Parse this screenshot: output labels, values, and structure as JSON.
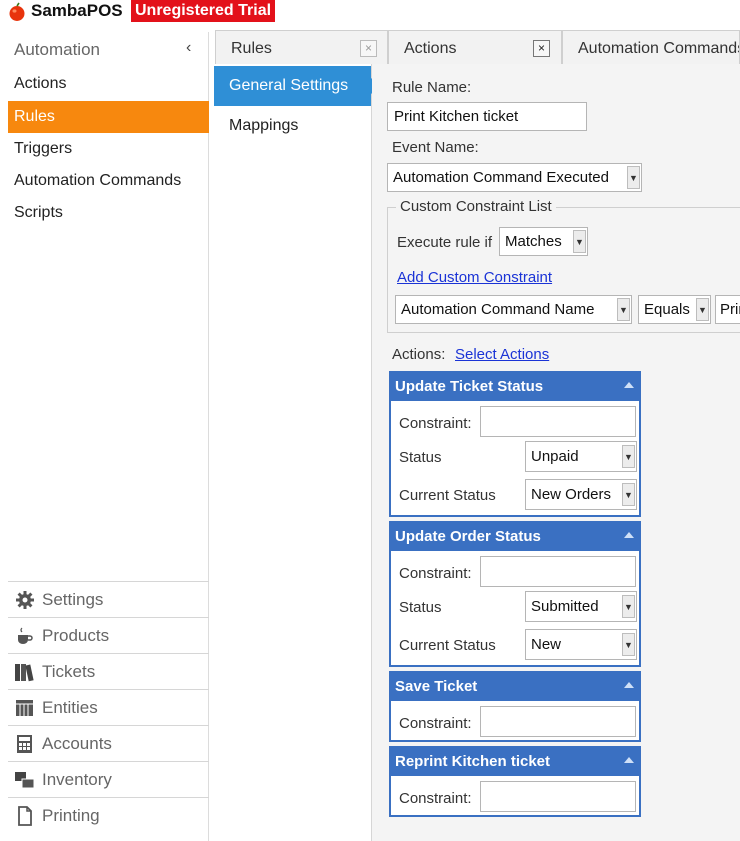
{
  "app": {
    "name": "SambaPOS",
    "trial_badge": "Unregistered Trial"
  },
  "sidebar": {
    "title": "Automation",
    "collapse_glyph": "‹",
    "items": [
      {
        "label": "Actions",
        "active": false
      },
      {
        "label": "Rules",
        "active": true
      },
      {
        "label": "Triggers",
        "active": false
      },
      {
        "label": "Automation Commands",
        "active": false
      },
      {
        "label": "Scripts",
        "active": false
      }
    ],
    "sections": [
      {
        "label": "Settings",
        "icon": "gear-icon"
      },
      {
        "label": "Products",
        "icon": "coffee-cup-icon"
      },
      {
        "label": "Tickets",
        "icon": "books-icon"
      },
      {
        "label": "Entities",
        "icon": "table-grid-icon"
      },
      {
        "label": "Accounts",
        "icon": "calculator-icon"
      },
      {
        "label": "Inventory",
        "icon": "boxes-icon"
      },
      {
        "label": "Printing",
        "icon": "document-icon"
      }
    ]
  },
  "tabs": [
    {
      "label": "Rules",
      "close": "×"
    },
    {
      "label": "Actions",
      "close": "×"
    },
    {
      "label": "Automation Commands"
    }
  ],
  "subnav": {
    "items": [
      {
        "label": "General Settings",
        "active": true
      },
      {
        "label": "Mappings",
        "active": false
      }
    ]
  },
  "form": {
    "rule_name_label": "Rule Name:",
    "rule_name_value": "Print Kitchen ticket",
    "event_name_label": "Event Name:",
    "event_name_value": "Automation Command Executed",
    "constraint_group_title": "Custom Constraint List",
    "execute_rule_label": "Execute rule if",
    "execute_rule_value": "Matches",
    "add_constraint_link": "Add Custom Constraint",
    "constraint_field": "Automation Command Name",
    "constraint_operator": "Equals",
    "constraint_value": "Print Kitchen ticket",
    "actions_label": "Actions:",
    "select_actions_link": "Select Actions"
  },
  "actions": [
    {
      "title": "Update Ticket Status",
      "constraint_label": "Constraint:",
      "status_label": "Status",
      "status_value": "Unpaid",
      "current_status_label": "Current Status",
      "current_status_value": "New Orders"
    },
    {
      "title": "Update Order Status",
      "constraint_label": "Constraint:",
      "status_label": "Status",
      "status_value": "Submitted",
      "current_status_label": "Current Status",
      "current_status_value": "New"
    },
    {
      "title": "Save Ticket",
      "constraint_label": "Constraint:"
    },
    {
      "title": "Reprint Kitchen ticket",
      "constraint_label": "Constraint:"
    }
  ],
  "colors": {
    "accent_orange": "#f7880e",
    "accent_blue": "#2f8fd6",
    "card_header_blue": "#3a70c2",
    "trial_red": "#e3111a"
  }
}
